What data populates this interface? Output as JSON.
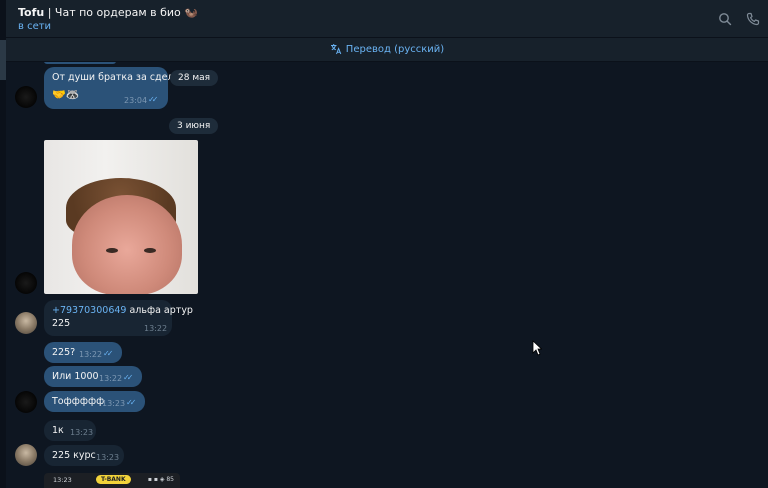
{
  "header": {
    "title_bold": "Tofu",
    "title_rest": " | Чат по ордерам в био 🦦",
    "status": "в сети"
  },
  "translate": {
    "label": "Перевод (русский)"
  },
  "messages": [
    {
      "text": "От души братка за сделку",
      "time": "23:04",
      "emoji": "🤝🦝"
    },
    {
      "date": "28 мая"
    },
    {
      "date": "3 июня"
    },
    {
      "phone": "+79370300649",
      "rest": " альфа артур",
      "line2": "225",
      "time": "13:22"
    },
    {
      "text": "225?",
      "time": "13:22"
    },
    {
      "text": "Или 1000",
      "time": "13:22"
    },
    {
      "text": "Тоффффф",
      "time": "13:23"
    },
    {
      "text": "1к",
      "time": "13:23"
    },
    {
      "text": "225 курс",
      "time": "13:23"
    }
  ],
  "screenshot_preview": {
    "time": "13:23",
    "bank": "T-BANK",
    "icons": "▪ ▪ ◈ 85"
  },
  "colors": {
    "bg": "#0e1621",
    "header": "#17212b",
    "outgoing": "#2b5278",
    "incoming": "#182533",
    "accent": "#6ab3f3"
  }
}
